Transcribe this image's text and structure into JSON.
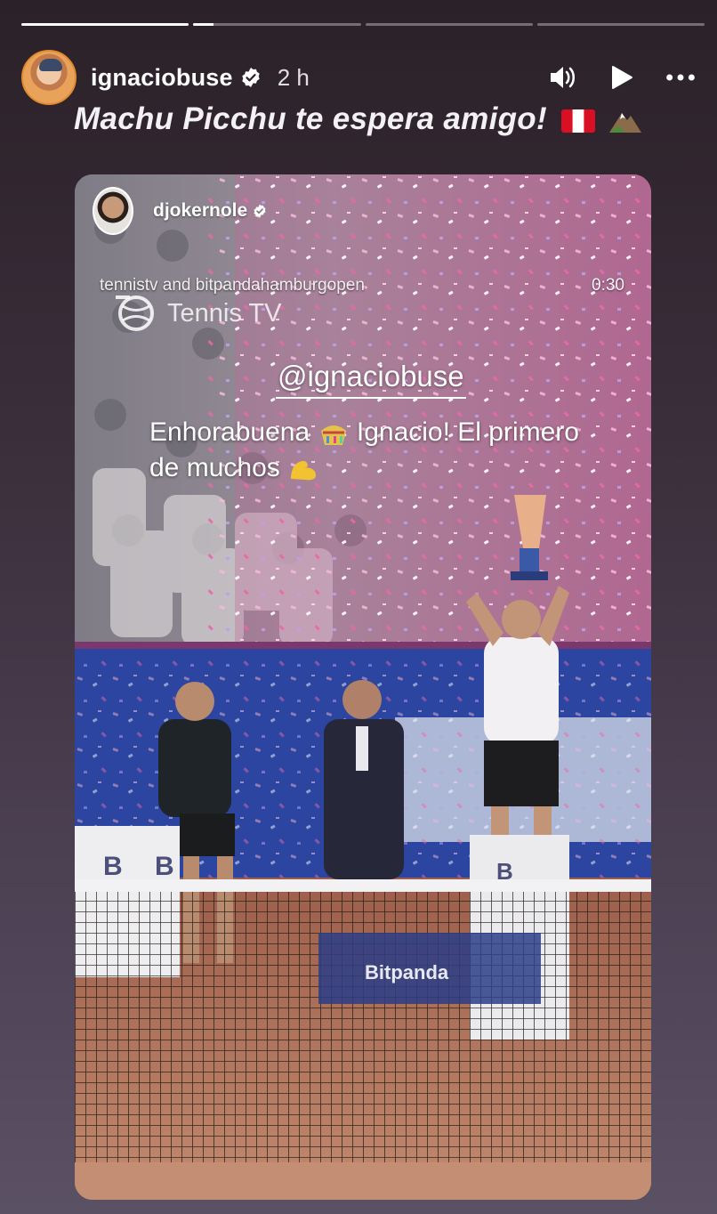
{
  "story": {
    "progress_segments": [
      1.0,
      0.12,
      0.0,
      0.0
    ],
    "username": "ignaciobuse",
    "time_ago": "2 h",
    "caption": "Machu Picchu te espera amigo!",
    "icons": {
      "avatar": "avatar",
      "verified": "verified-badge-icon",
      "sound": "speaker-icon",
      "play": "play-icon",
      "more": "more-options-icon",
      "flag": "peru-flag-icon",
      "mountain": "mountain-icon"
    }
  },
  "shared_post": {
    "repost_username": "djokernole",
    "credit": "tennistv and bitpandahamburgopen",
    "duration": "0:30",
    "logo_text": "Tennis TV",
    "mention": "@ignaciobuse",
    "message_part1": "Enhorabuena",
    "message_part2": "Ignacio! El primero de muchos",
    "emojis": [
      "confetti-ball-icon",
      "flexed-biceps-icon"
    ],
    "board_letter": "B",
    "banner_text": "Bitpanda"
  },
  "colors": {
    "accent_ring": "#e38a2f",
    "verified_blue": "#3897f0",
    "clay": "#b8755a",
    "stand_blue": "#2b45a0"
  }
}
